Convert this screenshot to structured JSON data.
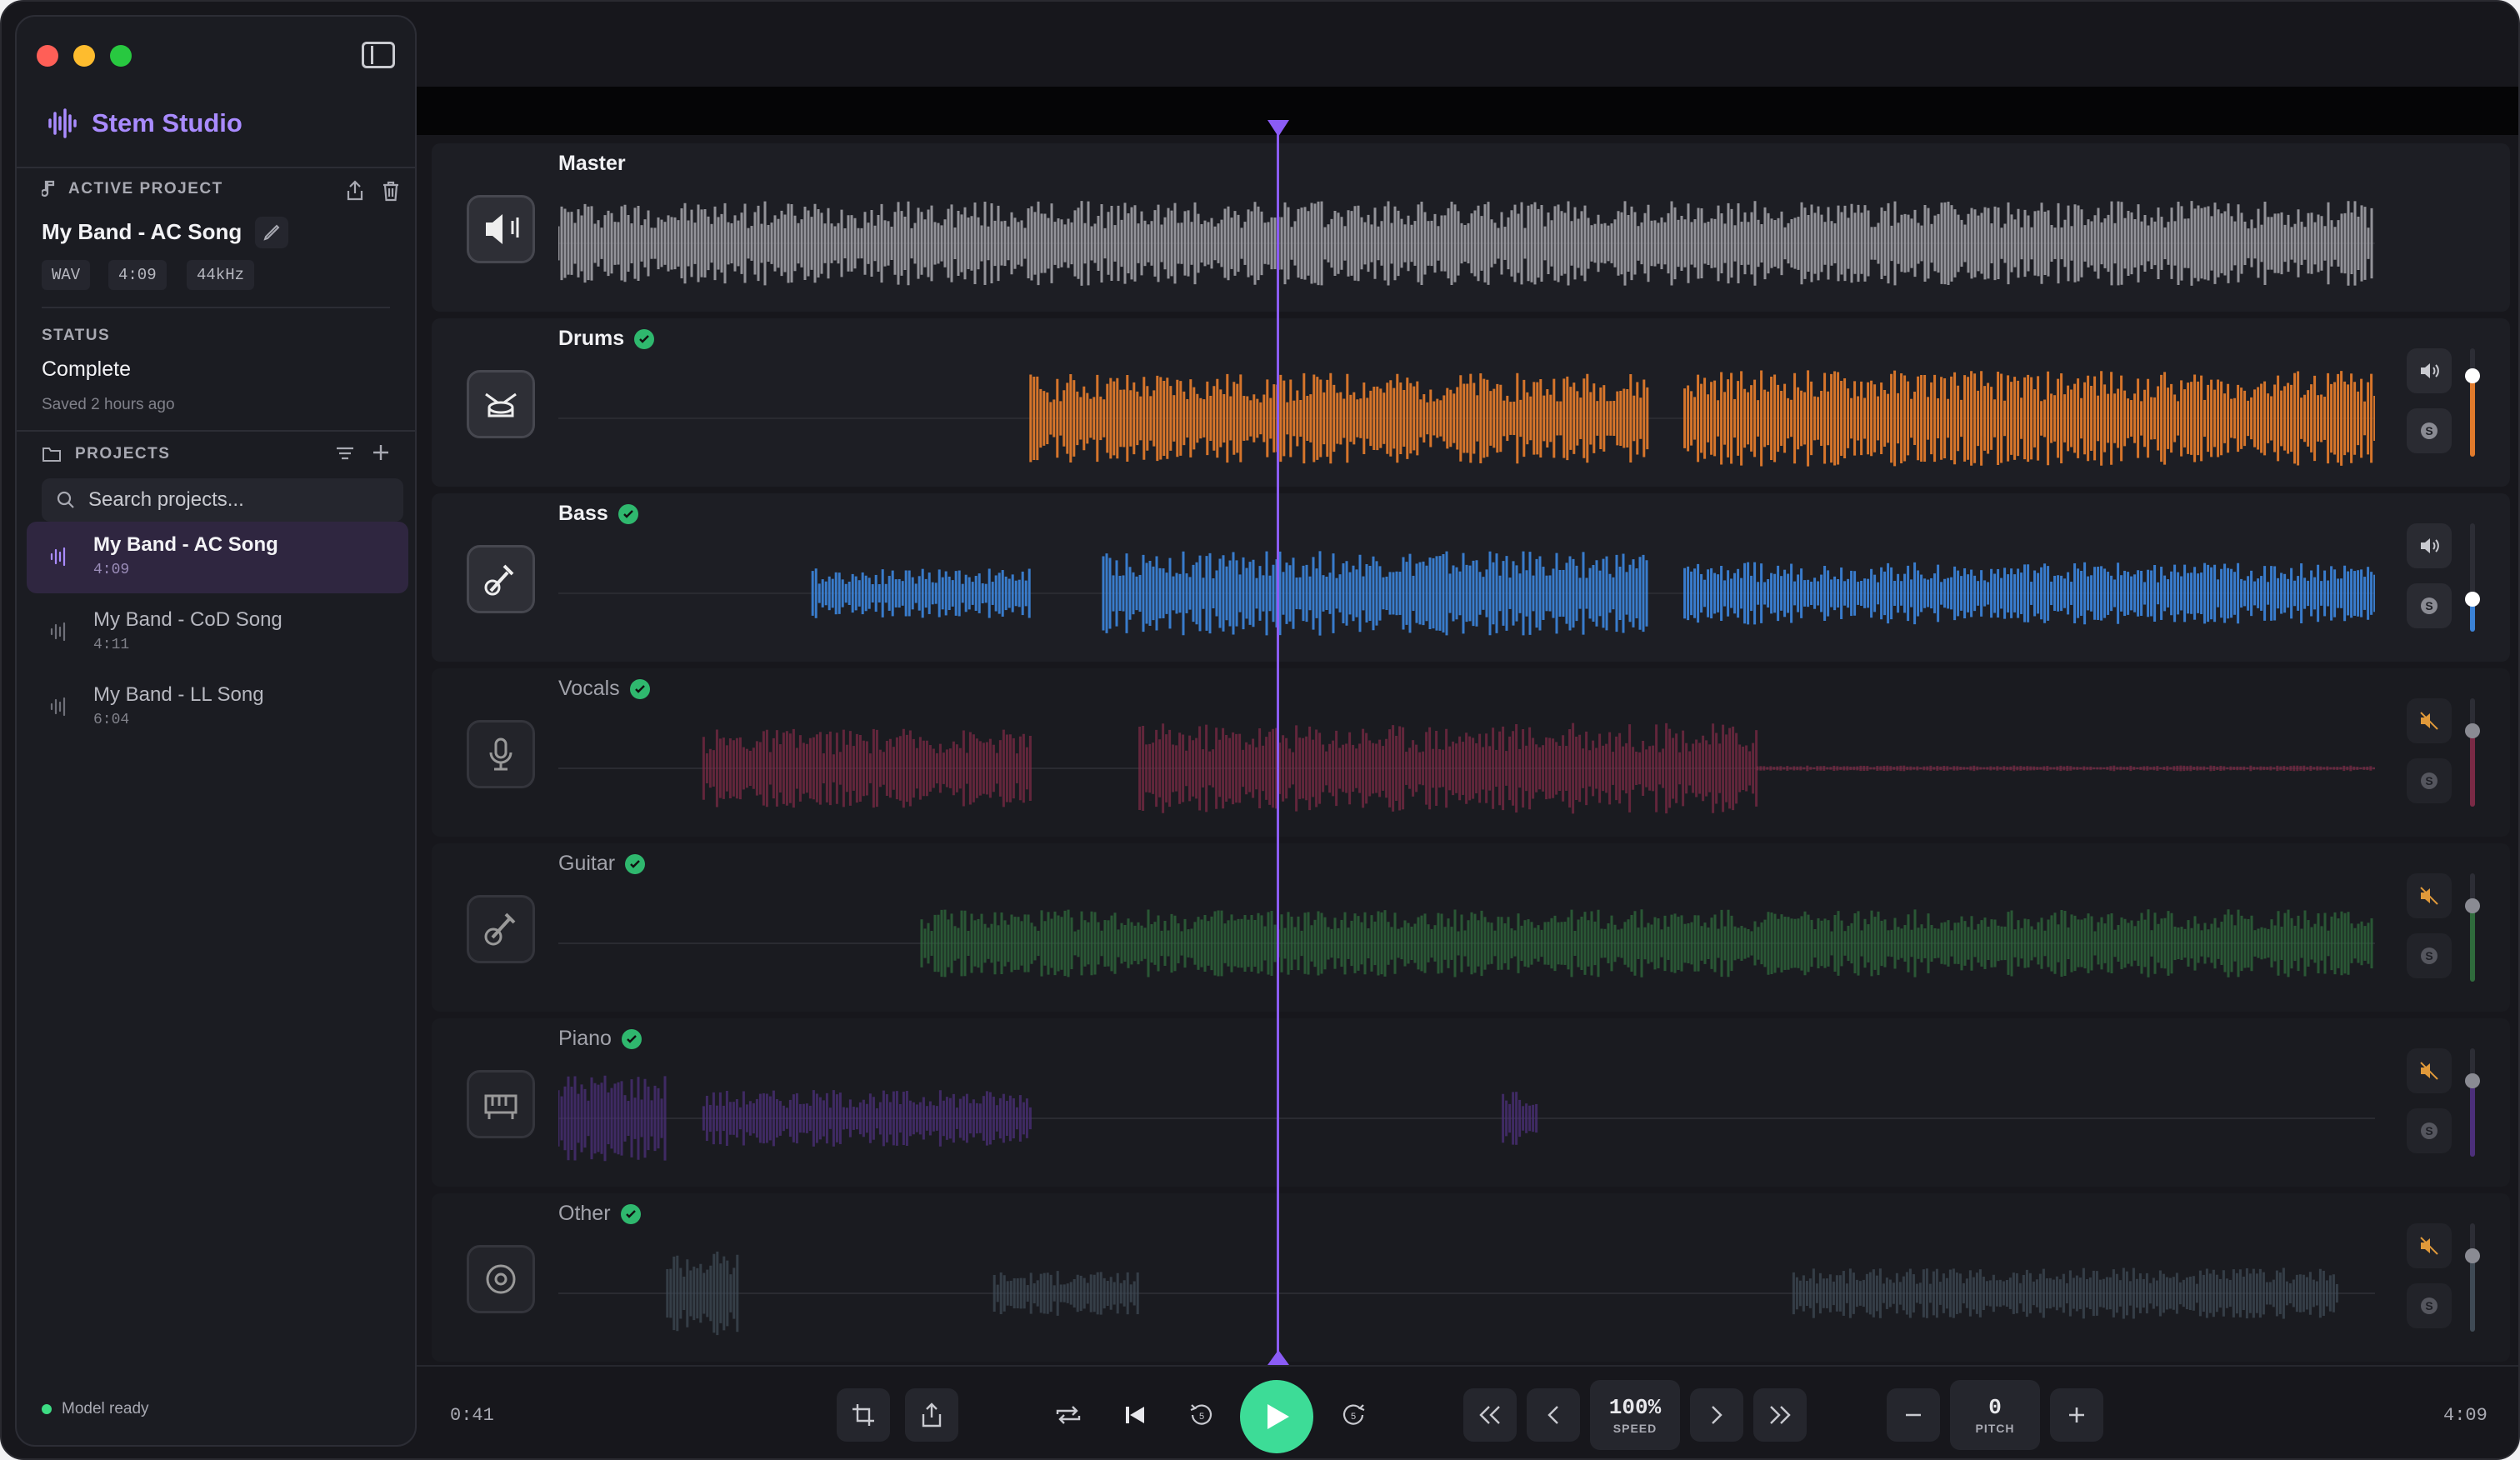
{
  "app": {
    "name": "Stem Studio"
  },
  "active_project": {
    "section_label": "ACTIVE PROJECT",
    "title": "My Band - AC Song",
    "format": "WAV",
    "duration": "4:09",
    "sample_rate": "44kHz",
    "status_label": "STATUS",
    "status": "Complete",
    "saved": "Saved 2 hours ago"
  },
  "projects": {
    "section_label": "PROJECTS",
    "search_placeholder": "Search projects...",
    "items": [
      {
        "name": "My Band - AC Song",
        "duration": "4:09",
        "active": true
      },
      {
        "name": "My Band - CoD Song",
        "duration": "4:11",
        "active": false
      },
      {
        "name": "My Band - LL Song",
        "duration": "6:04",
        "active": false
      }
    ]
  },
  "footer": {
    "model_status": "Model ready"
  },
  "tracks": [
    {
      "name": "Master",
      "color": "#9a9aa0",
      "complete": false,
      "muted": false,
      "volume": null
    },
    {
      "name": "Drums",
      "color": "#e07a2c",
      "complete": true,
      "muted": false,
      "volume": 0.75
    },
    {
      "name": "Bass",
      "color": "#3b82d6",
      "complete": true,
      "muted": false,
      "volume": 0.3
    },
    {
      "name": "Vocals",
      "color": "#7a2a45",
      "complete": true,
      "muted": true,
      "volume": 0.7
    },
    {
      "name": "Guitar",
      "color": "#2f6b3c",
      "complete": true,
      "muted": true,
      "volume": 0.7
    },
    {
      "name": "Piano",
      "color": "#4c2f7a",
      "complete": true,
      "muted": true,
      "volume": 0.7
    },
    {
      "name": "Other",
      "color": "#3f4a55",
      "complete": true,
      "muted": true,
      "volume": 0.7
    }
  ],
  "playhead": {
    "position": 0.164
  },
  "transport": {
    "current_time": "0:41",
    "total_time": "4:09",
    "speed_value": "100%",
    "speed_label": "SPEED",
    "pitch_value": "0",
    "pitch_label": "PITCH"
  },
  "colors": {
    "accent": "#8b5cf6",
    "play": "#3ddc97",
    "brand": "#a98bff"
  }
}
